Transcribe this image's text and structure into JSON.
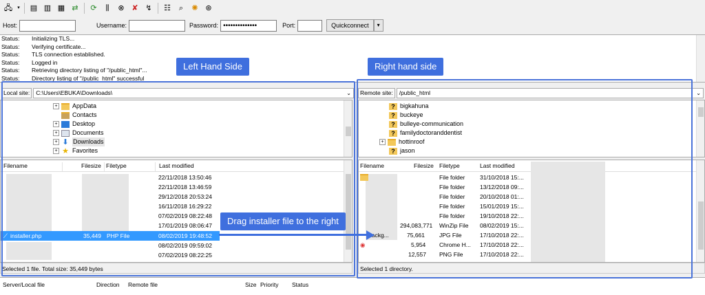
{
  "toolbar": {
    "icons": [
      "site-manager-icon",
      "dropdown-arrow-icon",
      "toggle-log-icon",
      "toggle-local-tree-icon",
      "toggle-remote-tree-icon",
      "transfer-queue-icon",
      "refresh-icon",
      "process-queue-icon",
      "cancel-icon",
      "disconnect-icon",
      "reconnect-icon",
      "filter-icon",
      "search-icon",
      "compare-icon",
      "find-icon"
    ]
  },
  "quickconnect": {
    "host_label": "Host:",
    "username_label": "Username:",
    "password_label": "Password:",
    "password_value": "••••••••••••••",
    "port_label": "Port:",
    "connect_button": "Quickconnect",
    "dropdown": "▾"
  },
  "log": [
    {
      "label": "Status:",
      "text": "Initializing TLS..."
    },
    {
      "label": "Status:",
      "text": "Verifying certificate..."
    },
    {
      "label": "Status:",
      "text": "TLS connection established."
    },
    {
      "label": "Status:",
      "text": "Logged in"
    },
    {
      "label": "Status:",
      "text": "Retrieving directory listing of \"/public_html\"..."
    },
    {
      "label": "Status:",
      "text": "Directory listing of \"/public_html\" successful"
    }
  ],
  "local": {
    "site_label": "Local site:",
    "path": "C:\\Users\\EBUKA\\Downloads\\",
    "tree": [
      "AppData",
      "Contacts",
      "Desktop",
      "Documents",
      "Downloads",
      "Favorites"
    ],
    "headers": {
      "filename": "Filename",
      "filesize": "Filesize",
      "filetype": "Filetype",
      "modified": "Last modified"
    },
    "dates": [
      "22/11/2018 13:50:46",
      "22/11/2018 13:46:59",
      "29/12/2018 20:53:24",
      "16/11/2018 16:29:22",
      "07/02/2019 08:22:48",
      "17/01/2019 08:06:47"
    ],
    "selected": {
      "name": "installer.php",
      "size": "35,449",
      "type": "PHP File",
      "modified": "08/02/2019 19:48:52"
    },
    "dates_after": [
      "08/02/2019 09:59:02",
      "07/02/2019 08:22:25"
    ],
    "status": "Selected 1 file. Total size: 35,449 bytes"
  },
  "remote": {
    "site_label": "Remote site:",
    "path": "/public_html",
    "tree": [
      "bigkahuna",
      "buckeye",
      "bulleye-communication",
      "familydoctoranddentist",
      "hottinroof",
      "jason"
    ],
    "headers": {
      "filename": "Filename",
      "filesize": "Filesize",
      "filetype": "Filetype",
      "modified": "Last modified"
    },
    "rows": [
      {
        "name": "",
        "size": "",
        "type": "File folder",
        "modified": "31/10/2018 15:..."
      },
      {
        "name": "",
        "size": "",
        "type": "File folder",
        "modified": "13/12/2018 09:..."
      },
      {
        "name": "",
        "size": "",
        "type": "File folder",
        "modified": "20/10/2018 01:..."
      },
      {
        "name": "",
        "size": "",
        "type": "File folder",
        "modified": "15/01/2019 15:..."
      },
      {
        "name": "",
        "size": "",
        "type": "File folder",
        "modified": "19/10/2018 22:..."
      },
      {
        "name": "",
        "size": "294,083,771",
        "type": "WinZip File",
        "modified": "08/02/2019 15:..."
      },
      {
        "name": "backg...",
        "size": "75,661",
        "type": "JPG File",
        "modified": "17/10/2018 22:..."
      },
      {
        "name": "",
        "size": "5,954",
        "type": "Chrome H...",
        "modified": "17/10/2018 22:..."
      },
      {
        "name": "",
        "size": "12,557",
        "type": "PNG File",
        "modified": "17/10/2018 22:..."
      }
    ],
    "status": "Selected 1 directory."
  },
  "queue": {
    "headers": [
      "Server/Local file",
      "Direction",
      "Remote file",
      "Size",
      "Priority",
      "Status"
    ]
  },
  "annotations": {
    "left": "Left Hand Side",
    "right": "Right hand side",
    "drag": "Drag installer file to the right"
  },
  "colors": {
    "accent": "#3f6fde",
    "selection": "#3399ff",
    "folder": "#f3c85a"
  }
}
